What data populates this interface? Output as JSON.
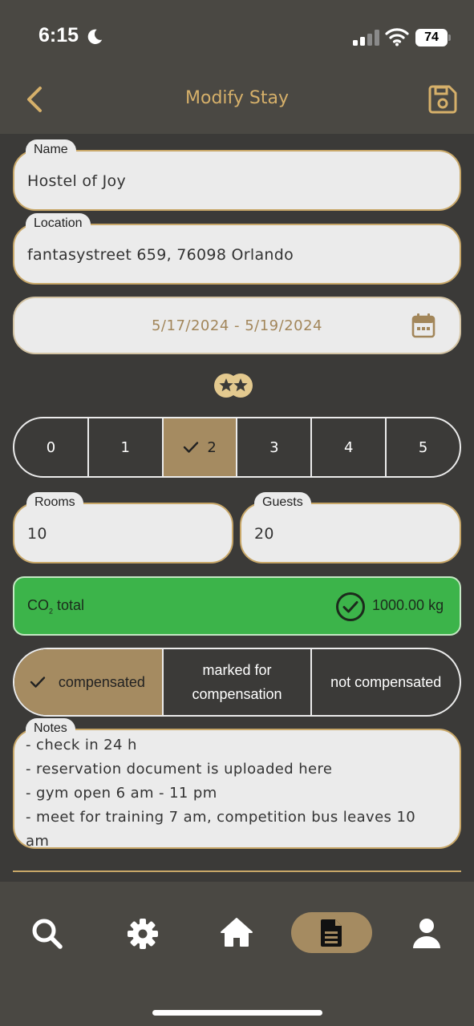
{
  "status": {
    "time": "6:15",
    "battery": "74"
  },
  "header": {
    "title": "Modify Stay"
  },
  "form": {
    "name": {
      "label": "Name",
      "value": "Hostel of Joy"
    },
    "location": {
      "label": "Location",
      "value": "fantasystreet 659, 76098 Orlando"
    },
    "dates": {
      "value": "5/17/2024 - 5/19/2024"
    },
    "stars": {
      "options": [
        "0",
        "1",
        "2",
        "3",
        "4",
        "5"
      ],
      "selected": "2"
    },
    "rooms": {
      "label": "Rooms",
      "value": "10"
    },
    "guests": {
      "label": "Guests",
      "value": "20"
    },
    "co2": {
      "label": "CO",
      "label_sub": "2",
      "label_suffix": " total",
      "value": "1000.00 kg"
    },
    "compensation": {
      "options": [
        "compensated",
        "marked for compensation",
        "not compensated"
      ],
      "selected": "compensated"
    },
    "notes": {
      "label": "Notes",
      "lines": [
        "- check in 24 h",
        "- reservation document is uploaded here",
        "- gym open 6 am - 11 pm",
        "- meet for training 7 am, competition bus leaves 10 am"
      ]
    }
  },
  "nav": {
    "items": [
      "search-icon",
      "gear-icon",
      "home-icon",
      "document-icon",
      "user-icon"
    ],
    "active": "document-icon"
  },
  "colors": {
    "accent": "#c8a768",
    "active_segment": "#a58b61",
    "co2_ok": "#3cb44a",
    "background": "#3b3a38"
  }
}
